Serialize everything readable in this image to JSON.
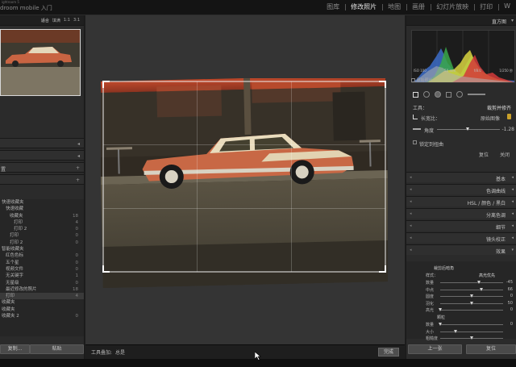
{
  "app": {
    "subtitle": "ightroom 5",
    "title": "droom mobile 入门"
  },
  "modules": [
    {
      "label": "图库",
      "active": false
    },
    {
      "label": "修改照片",
      "active": true
    },
    {
      "label": "地图",
      "active": false
    },
    {
      "label": "画册",
      "active": false
    },
    {
      "label": "幻灯片放映",
      "active": false
    },
    {
      "label": "打印",
      "active": false
    },
    {
      "label": "W",
      "active": false
    }
  ],
  "navigator": {
    "header_items": [
      "适合",
      "填满",
      "1:1",
      "3:1"
    ]
  },
  "left_sections": [
    {
      "label": "",
      "arrow": "◂"
    },
    {
      "label": "",
      "arrow": "◂"
    },
    {
      "label": "置",
      "arrow": "+"
    },
    {
      "label": "",
      "arrow": "+"
    }
  ],
  "collections": [
    {
      "label": "快速收藏夹",
      "count": "",
      "indent": 0,
      "highlight": false
    },
    {
      "label": "  快速收藏",
      "count": "",
      "indent": 1,
      "highlight": false
    },
    {
      "label": "    收藏夹",
      "count": "18",
      "indent": 2,
      "highlight": false
    },
    {
      "label": "      打印",
      "count": "4",
      "indent": 3,
      "highlight": false
    },
    {
      "label": "      打印 2",
      "count": "0",
      "indent": 3,
      "highlight": false
    },
    {
      "label": "    打印",
      "count": "0",
      "indent": 2,
      "highlight": false
    },
    {
      "label": "    打印 2",
      "count": "0",
      "indent": 2,
      "highlight": false
    },
    {
      "label": "智能收藏夹",
      "count": "",
      "indent": 0,
      "highlight": false
    },
    {
      "label": "  红色色标",
      "count": "0",
      "indent": 1,
      "highlight": false
    },
    {
      "label": "  五个星",
      "count": "0",
      "indent": 1,
      "highlight": false
    },
    {
      "label": "  视频文件",
      "count": "0",
      "indent": 1,
      "highlight": false
    },
    {
      "label": "  无关键字",
      "count": "1",
      "indent": 1,
      "highlight": false
    },
    {
      "label": "  无星级",
      "count": "0",
      "indent": 1,
      "highlight": false
    },
    {
      "label": "  最近修改的照片",
      "count": "18",
      "indent": 1,
      "highlight": false
    },
    {
      "label": "  打印",
      "count": "4",
      "indent": 1,
      "highlight": true
    },
    {
      "label": "收藏夹",
      "count": "",
      "indent": 0,
      "highlight": false
    },
    {
      "label": "收藏夹",
      "count": "",
      "indent": 0,
      "highlight": false
    },
    {
      "label": "收藏夹 2",
      "count": "0",
      "indent": 0,
      "highlight": false
    }
  ],
  "left_buttons": {
    "copy": "复制...",
    "paste": "粘贴"
  },
  "toolbar": {
    "tool_label": "工具叠加:",
    "overlay_label": "总是",
    "done": "完成"
  },
  "histogram": {
    "title": "直方图",
    "exif": [
      "ISO 100",
      "50 mm",
      "f/8.0",
      "1/250 秒"
    ],
    "original_label": "原始照片"
  },
  "crop": {
    "tool_label": "工具：",
    "title": "裁剪并修齐",
    "aspect_label": "长宽比：",
    "aspect_value": "原始图像",
    "angle_label": "角度",
    "angle_value": "-1.28",
    "constrain_label": "锁定到扭曲",
    "reset": "复位",
    "close": "关闭"
  },
  "right_sections": [
    {
      "label": "基本"
    },
    {
      "label": "色调曲线"
    },
    {
      "label": "HSL / 颜色 / 黑白"
    },
    {
      "label": "分离色调"
    },
    {
      "label": "细节"
    },
    {
      "label": "镜头校正"
    },
    {
      "label": "效果"
    }
  ],
  "effects": {
    "group1": "裁剪后暗角",
    "style_label": "样式：",
    "style_value": "高光优先",
    "sliders1": [
      {
        "name": "数量",
        "value": "-45",
        "pos": 0.62
      },
      {
        "name": "中点",
        "value": "66",
        "pos": 0.66
      },
      {
        "name": "圆度",
        "value": "0",
        "pos": 0.5
      },
      {
        "name": "羽化",
        "value": "50",
        "pos": 0.5
      },
      {
        "name": "高光",
        "value": "0",
        "pos": 0.0
      }
    ],
    "group2": "颗粒",
    "sliders2": [
      {
        "name": "数量",
        "value": "0",
        "pos": 0.0
      },
      {
        "name": "大小",
        "value": "",
        "pos": 0.25
      },
      {
        "name": "粗糙度",
        "value": "",
        "pos": 0.5
      }
    ]
  },
  "right_buttons": {
    "previous": "上一张",
    "reset": "复位"
  },
  "colors": {
    "accent_red": "#c05a3a",
    "panel_bg": "#2b2b2b",
    "center_bg": "#343434"
  }
}
